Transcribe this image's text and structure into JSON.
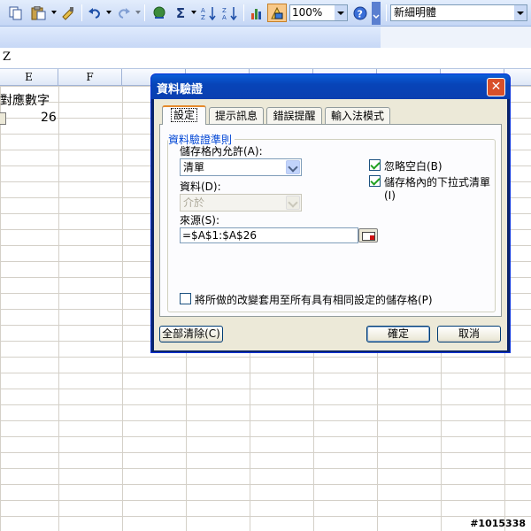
{
  "toolbar": {
    "zoom": "100%",
    "font_name": "新細明體",
    "autosum": "Σ"
  },
  "formula_bar": {
    "content": "Z"
  },
  "sheet": {
    "columns": [
      "E",
      "F"
    ],
    "cell_e1": "對應數字",
    "cell_e2": "26"
  },
  "dialog": {
    "title": "資料驗證",
    "close": "✕",
    "tabs": [
      {
        "label": "設定",
        "active": true
      },
      {
        "label": "提示訊息",
        "active": false
      },
      {
        "label": "錯誤提醒",
        "active": false
      },
      {
        "label": "輸入法模式",
        "active": false
      }
    ],
    "group_title": "資料驗證準則",
    "allow_label": "儲存格內允許(A):",
    "allow_value": "清單",
    "data_label": "資料(D):",
    "data_value": "介於",
    "source_label": "來源(S):",
    "source_value": "=$A$1:$A$26",
    "ignore_blank": {
      "label": "忽略空白(B)",
      "checked": true
    },
    "in_cell_dropdown": {
      "label": "儲存格內的下拉式清單(I)",
      "checked": true
    },
    "apply_all": {
      "label": "將所做的改變套用至所有具有相同設定的儲存格(P)",
      "checked": false
    },
    "clear_all": "全部清除(C)",
    "ok": "確定",
    "cancel": "取消"
  },
  "watermark": "#1015338"
}
